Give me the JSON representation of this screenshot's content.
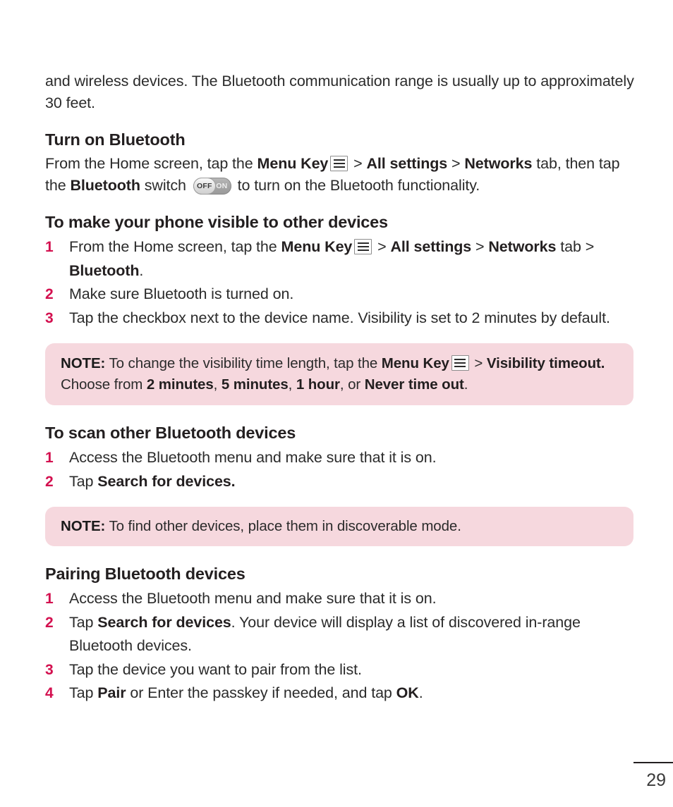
{
  "document": {
    "page_number": "29"
  },
  "intro": {
    "paragraph": "and wireless devices. The Bluetooth communication range is usually up to approximately 30 feet."
  },
  "icons": {
    "menu_key": "menu-key-icon",
    "toggle_off_label": "OFF",
    "toggle_on_label": "ON"
  },
  "colors": {
    "accent_pink": "#d3104f",
    "note_background": "#f6d8de",
    "body_text": "#2b2b2b",
    "heading_text": "#231f20"
  },
  "sections": {
    "turn_on": {
      "heading": "Turn on Bluetooth",
      "line1_a": "From the Home screen, tap the ",
      "line1_b": "Menu Key",
      "line1_c": " > ",
      "line1_d": "All settings",
      "line1_e": " > ",
      "line1_f": "Networks",
      "line1_g": " tab, then tap the ",
      "line1_h": "Bluetooth",
      "line1_i": " switch ",
      "line1_j": " to turn on the Bluetooth functionality."
    },
    "make_visible": {
      "heading": "To make your phone visible to other devices",
      "steps": [
        {
          "num": "1",
          "a": "From the Home screen, tap the ",
          "b": "Menu Key",
          "c": " > ",
          "d": "All settings",
          "e": " > ",
          "f": "Networks",
          "g": " tab > ",
          "h": "Bluetooth",
          "i": "."
        },
        {
          "num": "2",
          "text": "Make sure Bluetooth is turned on."
        },
        {
          "num": "3",
          "text": "Tap the checkbox next to the device name. Visibility is set to 2 minutes by default."
        }
      ],
      "note": {
        "label": "NOTE:",
        "a": " To change the visibility time length, tap the ",
        "b": "Menu Key",
        "c": " > ",
        "d": "Visibility timeout.",
        "e": " Choose from ",
        "f": "2 minutes",
        "g": ", ",
        "h": "5 minutes",
        "i": ", ",
        "j": "1 hour",
        "k": ", or ",
        "l": "Never time out",
        "m": "."
      }
    },
    "scan": {
      "heading": "To scan other Bluetooth devices",
      "steps": [
        {
          "num": "1",
          "text": "Access the Bluetooth menu and make sure that it is on."
        },
        {
          "num": "2",
          "a": "Tap ",
          "b": "Search for devices."
        }
      ],
      "note": {
        "label": "NOTE:",
        "a": " To find other devices, place them in discoverable mode."
      }
    },
    "pairing": {
      "heading": "Pairing Bluetooth devices",
      "steps": [
        {
          "num": "1",
          "text": "Access the Bluetooth menu and make sure that it is on."
        },
        {
          "num": "2",
          "a": "Tap ",
          "b": "Search for devices",
          "c": ". Your device will display a list of discovered in-range Bluetooth devices."
        },
        {
          "num": "3",
          "text": "Tap the device you want to pair from the list."
        },
        {
          "num": "4",
          "a": "Tap ",
          "b": "Pair",
          "c": " or Enter the passkey if needed, and tap ",
          "d": "OK",
          "e": "."
        }
      ]
    }
  }
}
